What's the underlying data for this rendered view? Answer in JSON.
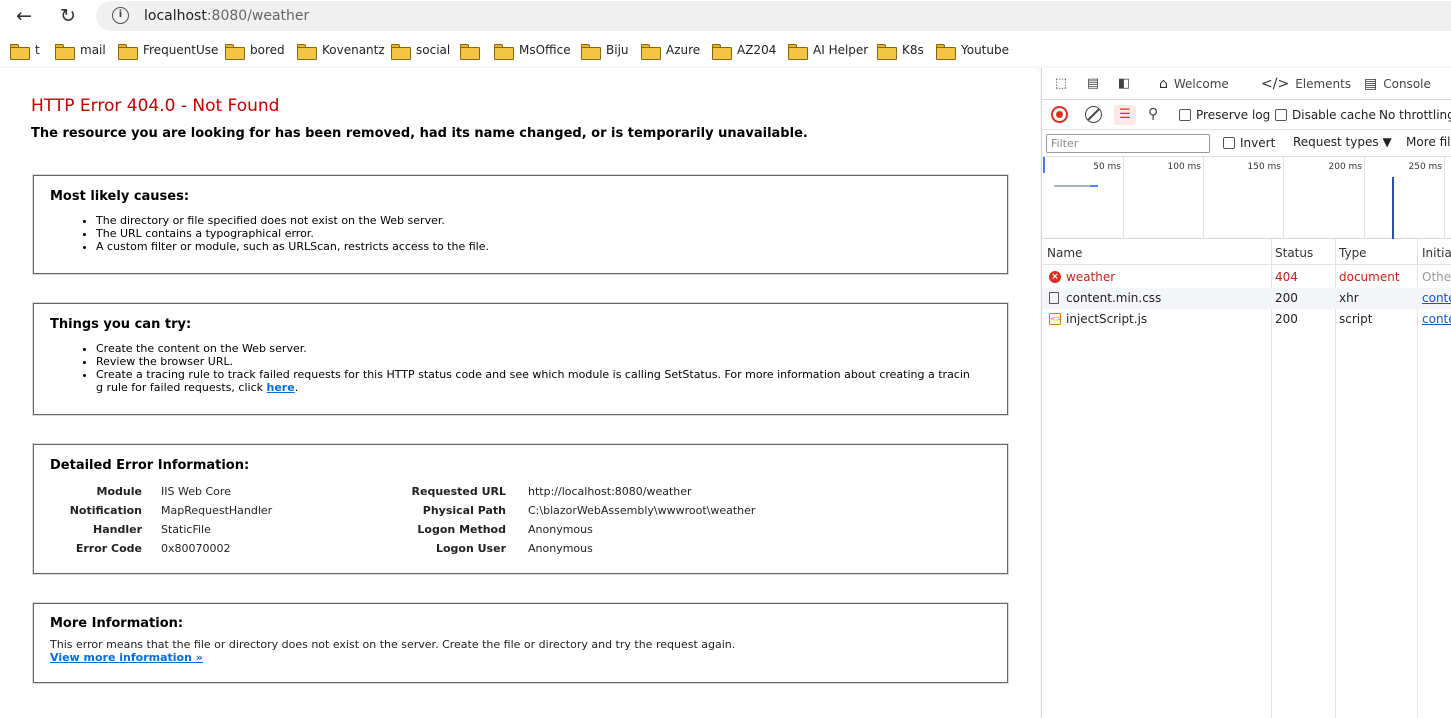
{
  "browser": {
    "address": {
      "host": "localhost",
      "path": ":8080/weather"
    },
    "bookmarks": [
      "t",
      "mail",
      "FrequentUse",
      "bored",
      "Kovenantz",
      "social",
      "MsOffice",
      "Biju",
      "Azure",
      "AZ204",
      "AI Helper",
      "K8s",
      "Youtube"
    ]
  },
  "page": {
    "title": "HTTP Error 404.0 - Not Found",
    "subtitle": "The resource you are looking for has been removed, had its name changed, or is temporarily unavailable.",
    "causes": {
      "heading": "Most likely causes:",
      "items": [
        "The directory or file specified does not exist on the Web server.",
        "The URL contains a typographical error.",
        "A custom filter or module, such as URLScan, restricts access to the file."
      ]
    },
    "try": {
      "heading": "Things you can try:",
      "items": [
        "Create the content on the Web server.",
        "Review the browser URL.",
        "Create a tracing rule to track failed requests for this HTTP status code and see which module is calling SetStatus. For more information about creating a tracin",
        "g rule for failed requests, click"
      ],
      "link": "here",
      "link_suffix": "."
    },
    "details": {
      "heading": "Detailed Error Information:",
      "left": [
        {
          "label": "Module",
          "value": "IIS Web Core"
        },
        {
          "label": "Notification",
          "value": "MapRequestHandler"
        },
        {
          "label": "Handler",
          "value": "StaticFile"
        },
        {
          "label": "Error Code",
          "value": "0x80070002"
        }
      ],
      "right": [
        {
          "label": "Requested URL",
          "value": "http://localhost:8080/weather"
        },
        {
          "label": "Physical Path",
          "value": "C:\\blazorWebAssembly\\wwwroot\\weather"
        },
        {
          "label": "Logon Method",
          "value": "Anonymous"
        },
        {
          "label": "Logon User",
          "value": "Anonymous"
        }
      ]
    },
    "more": {
      "heading": "More Information:",
      "text": "This error means that the file or directory does not exist on the server. Create the file or directory and try the request again.",
      "link": "View more information »"
    }
  },
  "devtools": {
    "tabs": {
      "welcome": "Welcome",
      "elements": "Elements",
      "console": "Console"
    },
    "toolbar": {
      "preserve_log": "Preserve log",
      "disable_cache": "Disable cache",
      "throttling": "No throttling"
    },
    "filter": {
      "placeholder": "Filter",
      "invert": "Invert",
      "request_types": "Request types",
      "more": "More filt"
    },
    "timeline_ticks": [
      "50 ms",
      "100 ms",
      "150 ms",
      "200 ms",
      "250 ms"
    ],
    "columns": {
      "name": "Name",
      "status": "Status",
      "type": "Type",
      "initiator": "Initiat"
    },
    "requests": [
      {
        "name": "weather",
        "status": "404",
        "type": "document",
        "initiator": "Other",
        "icon": "error-icon"
      },
      {
        "name": "content.min.css",
        "status": "200",
        "type": "xhr",
        "initiator": "conte",
        "icon": "file-icon"
      },
      {
        "name": "injectScript.js",
        "status": "200",
        "type": "script",
        "initiator": "conte",
        "icon": "script-icon"
      }
    ],
    "colors": {
      "error": "#d93025",
      "link": "#1a56c7",
      "title_red": "#c00000"
    }
  }
}
